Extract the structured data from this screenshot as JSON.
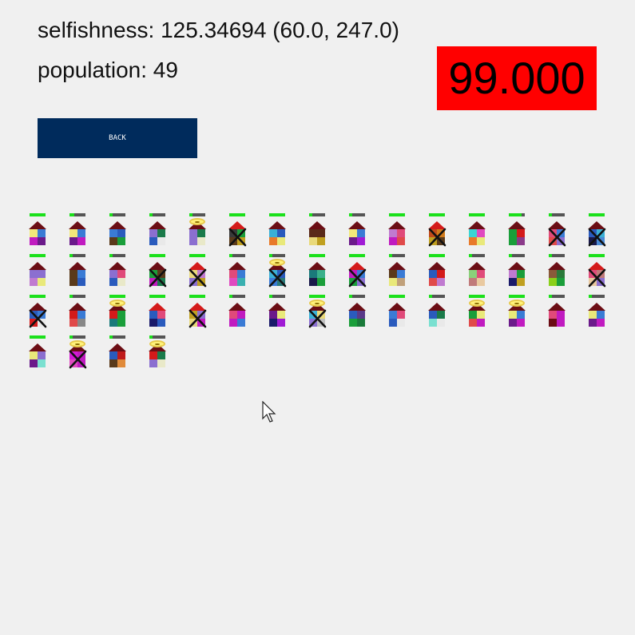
{
  "stats": {
    "selfishness": "selfishness: 125.34694 (60.0, 247.0)",
    "population": "population: 49"
  },
  "timer": "99.000",
  "back_button": "BACK",
  "colors": {
    "timer_bg": "#ff0000",
    "back_bg": "#002b5c",
    "health": "#1be01b",
    "background": "#f0f0f0"
  },
  "creatures": [
    {
      "health": 1.0,
      "roof": "#6b0d14",
      "q": [
        "#f2e97a",
        "#3a7bd5",
        "#c01bc0",
        "#6b1a8a"
      ],
      "halo": false,
      "dead": false
    },
    {
      "health": 0.3,
      "roof": "#6b0d14",
      "q": [
        "#f2e97a",
        "#3a7bd5",
        "#6b1a8a",
        "#c01bc0"
      ],
      "halo": false,
      "dead": false
    },
    {
      "health": 0.2,
      "roof": "#6b0d14",
      "q": [
        "#3a7bd5",
        "#2a5bbd",
        "#5a3a1a",
        "#1a9e3a"
      ],
      "halo": false,
      "dead": false
    },
    {
      "health": 0.2,
      "roof": "#6b0d14",
      "q": [
        "#8b6fd0",
        "#1a7a4a",
        "#2a5bbd",
        "#e9e9e9"
      ],
      "halo": false,
      "dead": false
    },
    {
      "health": 0.2,
      "roof": "#6b0d14",
      "q": [
        "#8b6fd0",
        "#1a7a4a",
        "#8b6fd0",
        "#e9e9c9"
      ],
      "halo": true,
      "dead": false
    },
    {
      "health": 1.0,
      "roof": "#d41a1a",
      "q": [
        "#3a3a3a",
        "#1a9e3a",
        "#5a3a1a",
        "#c0a020"
      ],
      "halo": false,
      "dead": true
    },
    {
      "health": 1.0,
      "roof": "#6b0d14",
      "q": [
        "#3ab0d5",
        "#2a5bbd",
        "#e87a2a",
        "#e9e97a"
      ],
      "halo": false,
      "dead": false
    },
    {
      "health": 0.2,
      "roof": "#6b0d14",
      "q": [
        "#5a2a1a",
        "#5a2a1a",
        "#e9d97a",
        "#c0a020"
      ],
      "halo": false,
      "dead": false
    },
    {
      "health": 0.2,
      "roof": "#6b0d14",
      "q": [
        "#f2e97a",
        "#3a7bd5",
        "#6b1a8a",
        "#a01bd5"
      ],
      "halo": false,
      "dead": false
    },
    {
      "health": 1.0,
      "roof": "#6b0d14",
      "q": [
        "#c07ad0",
        "#e04a7a",
        "#c01bc0",
        "#e04a4a"
      ],
      "halo": false,
      "dead": false
    },
    {
      "health": 1.0,
      "roof": "#d41a1a",
      "q": [
        "#c04a1a",
        "#d07a1a",
        "#c0a020",
        "#5a3a1a"
      ],
      "halo": false,
      "dead": true
    },
    {
      "health": 1.0,
      "roof": "#6b0d14",
      "q": [
        "#3ad5d5",
        "#e04ac0",
        "#e87a2a",
        "#e9e97a"
      ],
      "halo": false,
      "dead": false
    },
    {
      "health": 0.8,
      "roof": "#6b0d14",
      "q": [
        "#1a9e3a",
        "#d41a1a",
        "#1a9e3a",
        "#8b3a8a"
      ],
      "halo": false,
      "dead": false
    },
    {
      "health": 0.2,
      "roof": "#6b0d14",
      "q": [
        "#e04a7a",
        "#3a7bd5",
        "#e04a4a",
        "#8b6fd0"
      ],
      "halo": false,
      "dead": true
    },
    {
      "health": 1.0,
      "roof": "#6b0d14",
      "q": [
        "#2a5bbd",
        "#3ab0d5",
        "#1a1a4a",
        "#4a8ad5"
      ],
      "halo": false,
      "dead": true
    },
    {
      "health": 1.0,
      "roof": "#6b0d14",
      "q": [
        "#8b6fd0",
        "#8b6fd0",
        "#c07ad0",
        "#e9e97a"
      ],
      "halo": false,
      "dead": false
    },
    {
      "health": 0.2,
      "roof": "#6b0d14",
      "q": [
        "#5a3a1a",
        "#3a7bd5",
        "#5a3a1a",
        "#2a5bbd"
      ],
      "halo": false,
      "dead": false
    },
    {
      "health": 0.2,
      "roof": "#6b0d14",
      "q": [
        "#8b6fd0",
        "#e04a7a",
        "#2a5bbd",
        "#e9e9c9"
      ],
      "halo": false,
      "dead": false
    },
    {
      "health": 1.0,
      "roof": "#6b0d14",
      "q": [
        "#1a9e3a",
        "#5a3a1a",
        "#c01bc0",
        "#1a7a4a"
      ],
      "halo": false,
      "dead": true
    },
    {
      "health": 1.0,
      "roof": "#d41a1a",
      "q": [
        "#e9d97a",
        "#c07ad0",
        "#8b6fd0",
        "#c0a020"
      ],
      "halo": false,
      "dead": true
    },
    {
      "health": 0.2,
      "roof": "#6b0d14",
      "q": [
        "#e04a7a",
        "#3a7bd5",
        "#e04ac0",
        "#3ab0b0"
      ],
      "halo": false,
      "dead": false
    },
    {
      "health": 0.2,
      "roof": "#6b0d14",
      "q": [
        "#3ab0d5",
        "#2a5bbd",
        "#3a7bd5",
        "#2a7a7a"
      ],
      "halo": true,
      "dead": true
    },
    {
      "health": 1.0,
      "roof": "#6b0d14",
      "q": [
        "#1a7a7a",
        "#3ab08a",
        "#1a1a4a",
        "#1a9e3a"
      ],
      "halo": false,
      "dead": false
    },
    {
      "health": 1.0,
      "roof": "#d41a1a",
      "q": [
        "#c01bc0",
        "#3a7bd5",
        "#1a9e3a",
        "#8b6fd0"
      ],
      "halo": false,
      "dead": true
    },
    {
      "health": 0.2,
      "roof": "#6b0d14",
      "q": [
        "#5a3a1a",
        "#3a7bd5",
        "#e9e97a",
        "#c0a07a"
      ],
      "halo": false,
      "dead": false
    },
    {
      "health": 1.0,
      "roof": "#6b0d14",
      "q": [
        "#2a5bbd",
        "#d41a1a",
        "#e04a4a",
        "#c07ad0"
      ],
      "halo": false,
      "dead": false
    },
    {
      "health": 0.2,
      "roof": "#6b0d14",
      "q": [
        "#8ad07a",
        "#e04a7a",
        "#c07a7a",
        "#e9c9a0"
      ],
      "halo": false,
      "dead": false
    },
    {
      "health": 0.2,
      "roof": "#6b0d14",
      "q": [
        "#c07ad0",
        "#1a9e3a",
        "#1a1a6a",
        "#c0a020"
      ],
      "halo": false,
      "dead": false
    },
    {
      "health": 0.2,
      "roof": "#6b0d14",
      "q": [
        "#8a5a3a",
        "#2a7a3a",
        "#8ad01a",
        "#1a9e3a"
      ],
      "halo": false,
      "dead": false
    },
    {
      "health": 1.0,
      "roof": "#d41a1a",
      "q": [
        "#e04a7a",
        "#c07a7a",
        "#e9c9a0",
        "#8b6fd0"
      ],
      "halo": false,
      "dead": true
    },
    {
      "health": 1.0,
      "roof": "#6b0d14",
      "q": [
        "#2a5bbd",
        "#3a7bd5",
        "#d41a1a",
        "#e9e9e9"
      ],
      "halo": false,
      "dead": true
    },
    {
      "health": 0.2,
      "roof": "#6b0d14",
      "q": [
        "#d41a1a",
        "#3a7bd5",
        "#e04a4a",
        "#888888"
      ],
      "halo": false,
      "dead": false
    },
    {
      "health": 1.0,
      "roof": "#6b0d14",
      "q": [
        "#d41a1a",
        "#1a9e3a",
        "#1a7a7a",
        "#1a9e3a"
      ],
      "halo": true,
      "dead": false
    },
    {
      "health": 1.0,
      "roof": "#d41a1a",
      "q": [
        "#2a5bbd",
        "#e04a7a",
        "#1a1a6a",
        "#2a5bbd"
      ],
      "halo": false,
      "dead": false
    },
    {
      "health": 1.0,
      "roof": "#d41a1a",
      "q": [
        "#c0a020",
        "#8b6fd0",
        "#e9d97a",
        "#c01bc0"
      ],
      "halo": false,
      "dead": true
    },
    {
      "health": 0.2,
      "roof": "#6b0d14",
      "q": [
        "#e04a7a",
        "#c01bc0",
        "#c01bc0",
        "#3a7bd5"
      ],
      "halo": false,
      "dead": false
    },
    {
      "health": 0.2,
      "roof": "#6b0d14",
      "q": [
        "#6b1a8a",
        "#e9e97a",
        "#1a1a6a",
        "#a01bd5"
      ],
      "halo": false,
      "dead": false
    },
    {
      "health": 1.0,
      "roof": "#6b0d14",
      "q": [
        "#3ab0d5",
        "#e9d97a",
        "#8b6fd0",
        "#c0c0c0"
      ],
      "halo": true,
      "dead": true
    },
    {
      "health": 0.2,
      "roof": "#6b0d14",
      "q": [
        "#2a5bbd",
        "#5a3a8a",
        "#1a9e3a",
        "#1a7a3a"
      ],
      "halo": false,
      "dead": false
    },
    {
      "health": 1.0,
      "roof": "#6b0d14",
      "q": [
        "#3a7bd5",
        "#e04a7a",
        "#2a5bbd",
        "#e9e9e9"
      ],
      "halo": false,
      "dead": false
    },
    {
      "health": 0.2,
      "roof": "#6b0d14",
      "q": [
        "#2a5bbd",
        "#1a7a4a",
        "#7ae0d0",
        "#e9e9e9"
      ],
      "halo": false,
      "dead": false
    },
    {
      "health": 1.0,
      "roof": "#6b0d14",
      "q": [
        "#1a9e3a",
        "#e9e97a",
        "#e04a4a",
        "#c01bc0"
      ],
      "halo": true,
      "dead": false
    },
    {
      "health": 1.0,
      "roof": "#6b0d14",
      "q": [
        "#e9e97a",
        "#3a7bd5",
        "#6b1a8a",
        "#c01bc0"
      ],
      "halo": true,
      "dead": false
    },
    {
      "health": 0.2,
      "roof": "#6b0d14",
      "q": [
        "#e04a7a",
        "#c01bc0",
        "#6b0d14",
        "#c01bc0"
      ],
      "halo": false,
      "dead": false
    },
    {
      "health": 0.2,
      "roof": "#6b0d14",
      "q": [
        "#e9e97a",
        "#3a7bd5",
        "#6b1a8a",
        "#c01bc0"
      ],
      "halo": false,
      "dead": false
    },
    {
      "health": 1.0,
      "roof": "#6b0d14",
      "q": [
        "#e9e97a",
        "#8b6fd0",
        "#6b1a8a",
        "#7ae0d0"
      ],
      "halo": false,
      "dead": false
    },
    {
      "health": 0.2,
      "roof": "#6b0d14",
      "q": [
        "#d41ad4",
        "#c01bc0",
        "#e04ac0",
        "#c01bc0"
      ],
      "halo": true,
      "dead": true
    },
    {
      "health": 0.2,
      "roof": "#6b0d14",
      "q": [
        "#2a5bbd",
        "#c01b1b",
        "#5a3a1a",
        "#e08a3a"
      ],
      "halo": false,
      "dead": false
    },
    {
      "health": 0.2,
      "roof": "#6b0d14",
      "q": [
        "#d41a1a",
        "#1a7a4a",
        "#8b6fd0",
        "#e9e9c9"
      ],
      "halo": true,
      "dead": false
    }
  ]
}
